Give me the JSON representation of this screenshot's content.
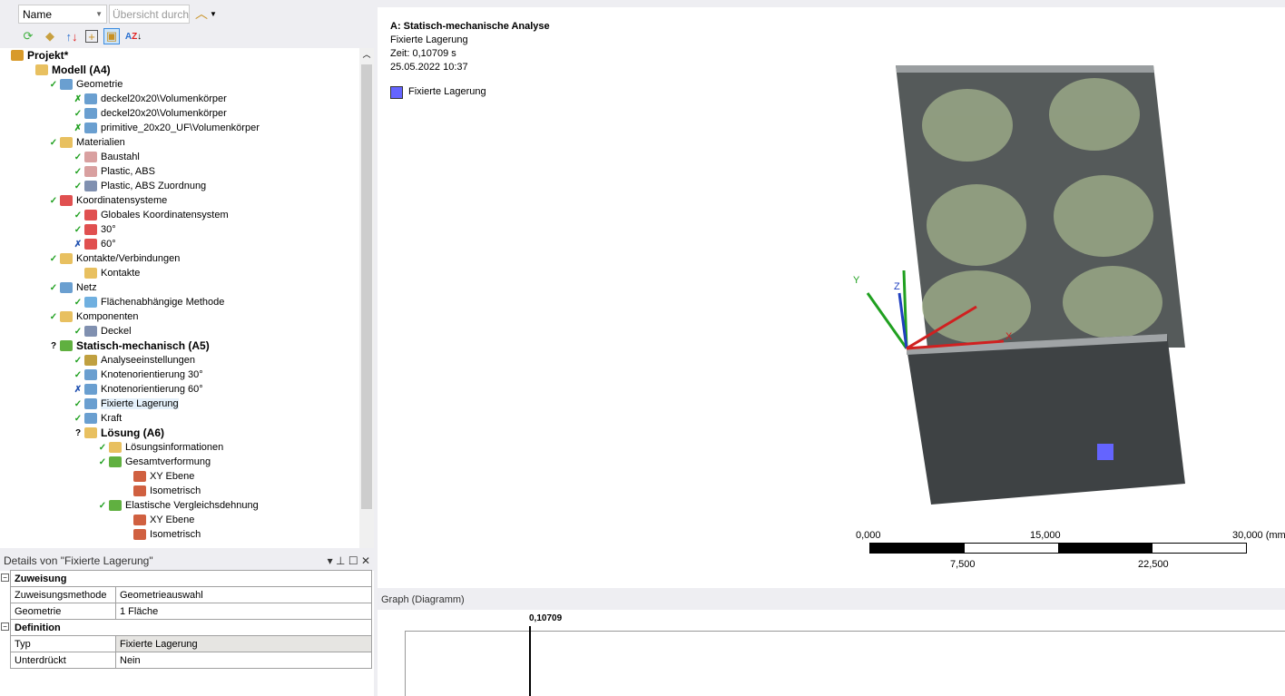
{
  "toolbar": {
    "sort_by": "Name",
    "search_placeholder": "Übersicht durch"
  },
  "tree": [
    {
      "label": "Projekt*",
      "level": 0,
      "bold": true,
      "status": "",
      "icon": "project-icon",
      "color": "#d89a2a"
    },
    {
      "label": "Modell (A4)",
      "level": 1,
      "bold": true,
      "status": "",
      "icon": "model-icon",
      "color": "#e8c060"
    },
    {
      "label": "Geometrie",
      "level": 2,
      "status": "check",
      "icon": "geometry-icon",
      "color": "#6a9fd0"
    },
    {
      "label": "deckel20x20\\Volumenkörper",
      "level": 3,
      "status": "x-green",
      "icon": "body-icon",
      "color": "#6a9fd0"
    },
    {
      "label": "deckel20x20\\Volumenkörper",
      "level": 3,
      "status": "check",
      "icon": "body-icon",
      "color": "#6a9fd0"
    },
    {
      "label": "primitive_20x20_UF\\Volumenkörper",
      "level": 3,
      "status": "x-green",
      "icon": "body-icon",
      "color": "#6a9fd0"
    },
    {
      "label": "Materialien",
      "level": 2,
      "status": "check",
      "icon": "materials-icon",
      "color": "#e8c060"
    },
    {
      "label": "Baustahl",
      "level": 3,
      "status": "check",
      "icon": "material-icon",
      "color": "#d9a0a0"
    },
    {
      "label": "Plastic, ABS",
      "level": 3,
      "status": "check",
      "icon": "material-icon",
      "color": "#d9a0a0"
    },
    {
      "label": "Plastic, ABS Zuordnung",
      "level": 3,
      "status": "check",
      "icon": "assignment-icon",
      "color": "#8090b0"
    },
    {
      "label": "Koordinatensysteme",
      "level": 2,
      "status": "check",
      "icon": "coordinate-icon",
      "color": "#e05050"
    },
    {
      "label": "Globales Koordinatensystem",
      "level": 3,
      "status": "check",
      "icon": "coordinate-icon",
      "color": "#e05050"
    },
    {
      "label": "30°",
      "level": 3,
      "status": "check",
      "icon": "coordinate-icon",
      "color": "#e05050"
    },
    {
      "label": "60°",
      "level": 3,
      "status": "x-blue",
      "icon": "coordinate-icon",
      "color": "#e05050"
    },
    {
      "label": "Kontakte/Verbindungen",
      "level": 2,
      "status": "check",
      "icon": "connections-icon",
      "color": "#e8c060"
    },
    {
      "label": "Kontakte",
      "level": 3,
      "status": "",
      "icon": "contacts-icon",
      "color": "#e8c060",
      "expander": "+"
    },
    {
      "label": "Netz",
      "level": 2,
      "status": "check",
      "icon": "mesh-icon",
      "color": "#6a9fd0"
    },
    {
      "label": "Flächenabhängige Methode",
      "level": 3,
      "status": "check",
      "icon": "mesh-method-icon",
      "color": "#70b0e0"
    },
    {
      "label": "Komponenten",
      "level": 2,
      "status": "check",
      "icon": "components-icon",
      "color": "#e8c060"
    },
    {
      "label": "Deckel",
      "level": 3,
      "status": "check",
      "icon": "component-icon",
      "color": "#8090b0"
    },
    {
      "label": "Statisch-mechanisch (A5)",
      "level": 2,
      "bold": true,
      "status": "?",
      "icon": "static-structural-icon",
      "color": "#60b040"
    },
    {
      "label": "Analyseeinstellungen",
      "level": 3,
      "status": "check",
      "icon": "analysis-settings-icon",
      "color": "#c0a040"
    },
    {
      "label": "Knotenorientierung 30°",
      "level": 3,
      "status": "check",
      "icon": "node-orientation-icon",
      "color": "#6a9fd0"
    },
    {
      "label": "Knotenorientierung 60°",
      "level": 3,
      "status": "x-blue",
      "icon": "node-orientation-icon",
      "color": "#6a9fd0"
    },
    {
      "label": "Fixierte Lagerung",
      "level": 3,
      "status": "check",
      "icon": "fixed-support-icon",
      "color": "#6a9fd0",
      "selected": true
    },
    {
      "label": "Kraft",
      "level": 3,
      "status": "check",
      "icon": "force-icon",
      "color": "#6a9fd0"
    },
    {
      "label": "Lösung (A6)",
      "level": 3,
      "bold": true,
      "status": "?",
      "icon": "solution-icon",
      "color": "#e8c060"
    },
    {
      "label": "Lösungsinformationen",
      "level": 4,
      "status": "check",
      "icon": "solution-info-icon",
      "color": "#e8c060"
    },
    {
      "label": "Gesamtverformung",
      "level": 4,
      "status": "check",
      "icon": "deformation-icon",
      "color": "#60b040"
    },
    {
      "label": "XY Ebene",
      "level": 5,
      "status": "",
      "icon": "result-view-icon",
      "color": "#d06040"
    },
    {
      "label": "Isometrisch",
      "level": 5,
      "status": "",
      "icon": "result-view-icon",
      "color": "#d06040"
    },
    {
      "label": "Elastische Vergleichsdehnung",
      "level": 4,
      "status": "check",
      "icon": "strain-icon",
      "color": "#60b040"
    },
    {
      "label": "XY Ebene",
      "level": 5,
      "status": "",
      "icon": "result-view-icon",
      "color": "#d06040"
    },
    {
      "label": "Isometrisch",
      "level": 5,
      "status": "",
      "icon": "result-view-icon",
      "color": "#d06040"
    }
  ],
  "details": {
    "title": "Details von \"Fixierte Lagerung\"",
    "groups": [
      {
        "name": "Zuweisung",
        "rows": [
          [
            "Zuweisungsmethode",
            "Geometrieauswahl"
          ],
          [
            "Geometrie",
            "1 Fläche"
          ]
        ]
      },
      {
        "name": "Definition",
        "rows": [
          [
            "Typ",
            "Fixierte Lagerung"
          ],
          [
            "Unterdrückt",
            "Nein"
          ]
        ]
      }
    ]
  },
  "viewport": {
    "title": "A: Statisch-mechanische Analyse",
    "subtitle": "Fixierte Lagerung",
    "time": "Zeit: 0,10709 s",
    "date": "25.05.2022 10:37",
    "legend": "Fixierte Lagerung",
    "legend_color": "#6464ff",
    "scale": {
      "top": [
        "0,000",
        "15,000",
        "30,000 (mm)"
      ],
      "bottom": [
        "7,500",
        "22,500"
      ]
    },
    "axes": {
      "x": "X",
      "y": "Y",
      "z": "Z"
    }
  },
  "graph": {
    "title": "Graph (Diagramm)",
    "marker": "0,10709"
  }
}
